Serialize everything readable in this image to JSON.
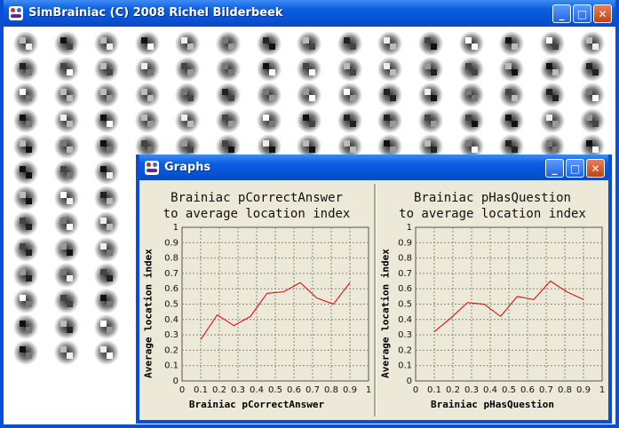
{
  "main_window": {
    "title": "SimBrainiac (C) 2008 Richel Bilderbeek",
    "icon": "app-icon",
    "buttons": {
      "minimize": "_",
      "maximize": "□",
      "close": "✕"
    }
  },
  "graphs_window": {
    "title": "Graphs",
    "icon": "app-icon",
    "buttons": {
      "minimize": "_",
      "maximize": "□",
      "close": "✕"
    }
  },
  "chart_data": [
    {
      "type": "line",
      "title_line1": "Brainiac pCorrectAnswer",
      "title_line2": "to average location index",
      "xlabel": "Brainiac pCorrectAnswer",
      "ylabel": "Average location index",
      "xlim": [
        0,
        1
      ],
      "ylim": [
        0,
        1
      ],
      "grid": true,
      "x_ticks": [
        "0",
        "0.1",
        "0.2",
        "0.3",
        "0.4",
        "0.5",
        "0.6",
        "0.7",
        "0.8",
        "0.9",
        "1"
      ],
      "y_ticks": [
        "0",
        "0.1",
        "0.2",
        "0.3",
        "0.4",
        "0.5",
        "0.6",
        "0.7",
        "0.8",
        "0.9",
        "1"
      ],
      "line_color": "#e00000",
      "x": [
        0.1,
        0.2,
        0.3,
        0.4,
        0.5,
        0.6,
        0.7,
        0.8,
        0.9
      ],
      "y": [
        0.27,
        0.43,
        0.36,
        0.42,
        0.57,
        0.58,
        0.64,
        0.54,
        0.5,
        0.64
      ]
    },
    {
      "type": "line",
      "title_line1": "Brainiac pHasQuestion",
      "title_line2": "to average location index",
      "xlabel": "Brainiac pHasQuestion",
      "ylabel": "Average location index",
      "xlim": [
        0,
        1
      ],
      "ylim": [
        0,
        1
      ],
      "grid": true,
      "x_ticks": [
        "0",
        "0.1",
        "0.2",
        "0.3",
        "0.4",
        "0.5",
        "0.6",
        "0.7",
        "0.8",
        "0.9",
        "1"
      ],
      "y_ticks": [
        "0",
        "0.1",
        "0.2",
        "0.3",
        "0.4",
        "0.5",
        "0.6",
        "0.7",
        "0.8",
        "0.9",
        "1"
      ],
      "line_color": "#e00000",
      "x": [
        0.1,
        0.2,
        0.3,
        0.4,
        0.5,
        0.6,
        0.7,
        0.8,
        0.9
      ],
      "y": [
        0.32,
        0.41,
        0.51,
        0.5,
        0.42,
        0.55,
        0.53,
        0.65,
        0.58,
        0.53
      ]
    }
  ]
}
